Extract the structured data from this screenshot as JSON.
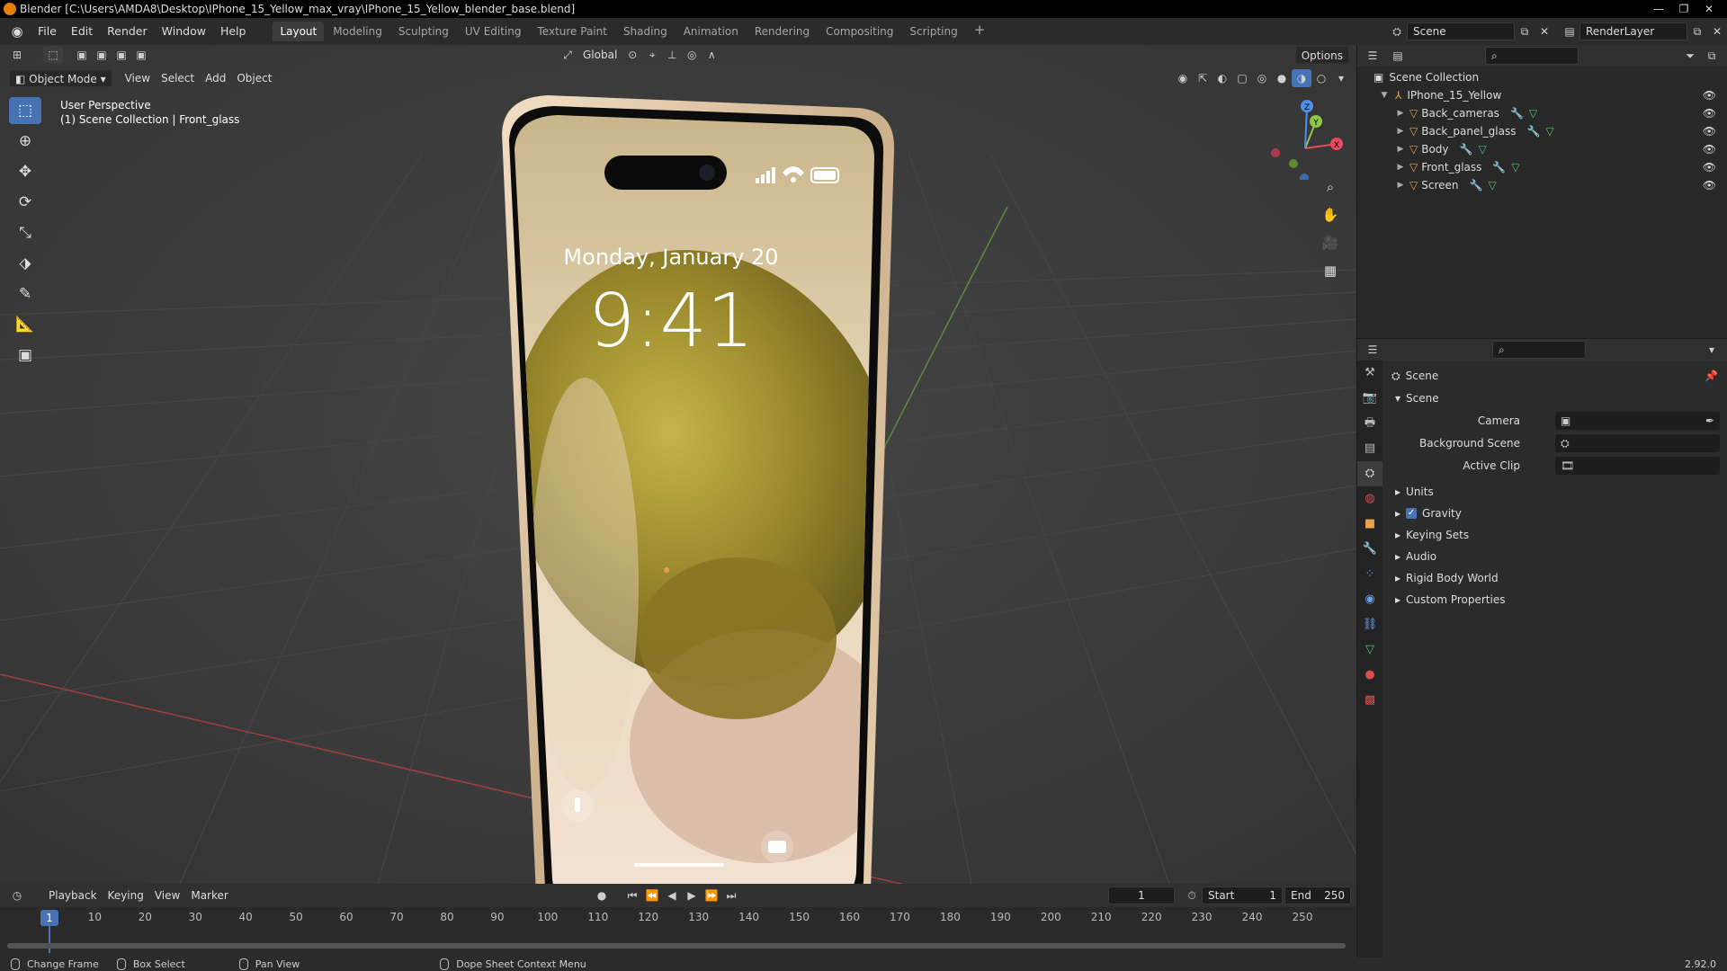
{
  "window": {
    "title": "Blender [C:\\Users\\AMDA8\\Desktop\\IPhone_15_Yellow_max_vray\\IPhone_15_Yellow_blender_base.blend]",
    "minimize": "—",
    "restore": "❐",
    "close": "✕"
  },
  "menu": {
    "items": [
      "File",
      "Edit",
      "Render",
      "Window",
      "Help"
    ]
  },
  "workspaces": {
    "tabs": [
      "Layout",
      "Modeling",
      "Sculpting",
      "UV Editing",
      "Texture Paint",
      "Shading",
      "Animation",
      "Rendering",
      "Compositing",
      "Scripting"
    ],
    "active": "Layout",
    "add": "+"
  },
  "top_right": {
    "scene_name": "Scene",
    "view_layer": "RenderLayer"
  },
  "viewport": {
    "transform_orientation": "Global",
    "options_label": "Options",
    "mode": "Object Mode",
    "header_menus": [
      "View",
      "Select",
      "Add",
      "Object"
    ],
    "overlay_title": "User Perspective",
    "overlay_subtitle": "(1) Scene Collection | Front_glass",
    "phone_date": "Monday, January 20",
    "phone_time": "9:41",
    "gizmo": {
      "x": "X",
      "y": "Y",
      "z": "Z"
    }
  },
  "timeline": {
    "menus": [
      "Playback",
      "Keying",
      "View",
      "Marker"
    ],
    "current_frame": "1",
    "start_label": "Start",
    "start": "1",
    "end_label": "End",
    "end": "250",
    "ticks": [
      "1",
      "10",
      "20",
      "30",
      "40",
      "50",
      "60",
      "70",
      "80",
      "90",
      "100",
      "110",
      "120",
      "130",
      "140",
      "150",
      "160",
      "170",
      "180",
      "190",
      "200",
      "210",
      "220",
      "230",
      "240",
      "250"
    ]
  },
  "statusbar": {
    "items": [
      "Change Frame",
      "Box Select",
      "Pan View",
      "Dope Sheet Context Menu"
    ],
    "version": "2.92.0"
  },
  "outliner": {
    "root": "Scene Collection",
    "collection": "IPhone_15_Yellow",
    "objects": [
      "Back_cameras",
      "Back_panel_glass",
      "Body",
      "Front_glass",
      "Screen"
    ]
  },
  "properties": {
    "context_title": "Scene",
    "panel_title": "Scene",
    "fields": [
      "Camera",
      "Background Scene",
      "Active Clip"
    ],
    "sections": [
      "Units",
      "Gravity",
      "Keying Sets",
      "Audio",
      "Rigid Body World",
      "Custom Properties"
    ],
    "gravity_checked": true
  },
  "colors": {
    "accent": "#4772b3",
    "object_orange": "#e8a04b",
    "wrench_blue": "#6da1e6",
    "mesh_green": "#4fc37d"
  }
}
